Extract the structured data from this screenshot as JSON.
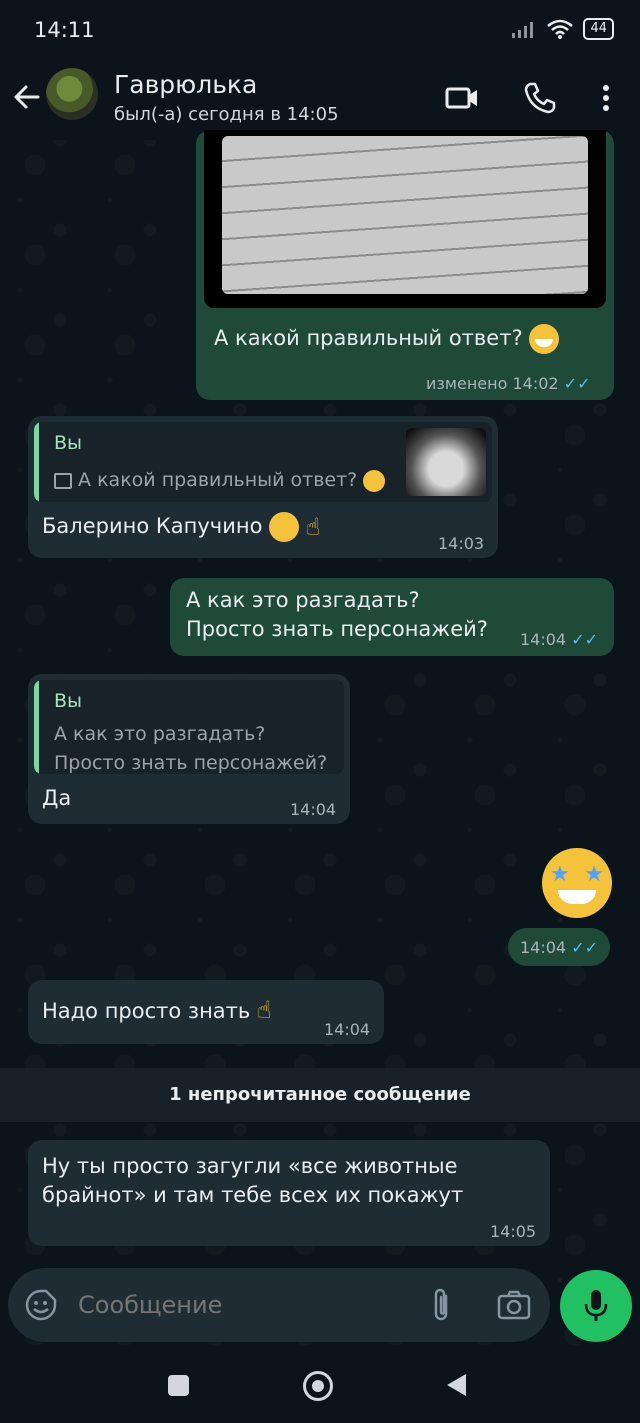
{
  "status_bar": {
    "time": "14:11",
    "battery": "44"
  },
  "header": {
    "contact_name": "Гаврюлька",
    "last_seen": "был(-а) сегодня в 14:05"
  },
  "messages": [
    {
      "direction": "out",
      "text": "А какой правильный ответ?",
      "edited_label": "изменено",
      "time": "14:02"
    },
    {
      "direction": "in",
      "quote_author": "Вы",
      "quote_text": "А какой правильный ответ?",
      "text": "Балерино Капучино",
      "time": "14:03"
    },
    {
      "direction": "out",
      "line1": "А как это разгадать?",
      "line2": "Просто знать персонажей?",
      "time": "14:04"
    },
    {
      "direction": "in",
      "quote_author": "Вы",
      "quote_line1": "А как это разгадать?",
      "quote_line2": "Просто знать персонажей?",
      "text": "Да",
      "time": "14:04"
    },
    {
      "direction": "out",
      "time": "14:04"
    },
    {
      "direction": "in",
      "text": "Надо просто знать",
      "time": "14:04"
    },
    {
      "direction": "in",
      "line1": "Ну ты просто загугли «все животные",
      "line2": "брайнот» и там тебе всех их покажут",
      "time": "14:05"
    }
  ],
  "unread_banner": "1 непрочитанное сообщение",
  "composer": {
    "placeholder": "Сообщение"
  },
  "colors": {
    "background": "#0b141a",
    "incoming": "#1f2c34",
    "outgoing": "#1f4a3a",
    "mic": "#21c063",
    "read_ticks": "#53bdeb"
  }
}
